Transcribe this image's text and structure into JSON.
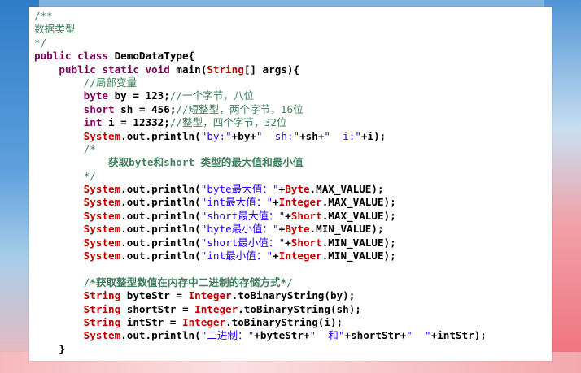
{
  "lines": [
    {
      "parts": [
        {
          "t": "/**",
          "c": "cmt"
        }
      ]
    },
    {
      "parts": [
        {
          "t": "数据类型",
          "c": "cmt"
        }
      ]
    },
    {
      "parts": [
        {
          "t": "*/",
          "c": "cmt"
        }
      ]
    },
    {
      "parts": [
        {
          "t": "public class ",
          "c": "kw"
        },
        {
          "t": "DemoDataType{",
          "c": "plain"
        }
      ]
    },
    {
      "parts": [
        {
          "t": "    public static void ",
          "c": "kw"
        },
        {
          "t": "main(",
          "c": "plain"
        },
        {
          "t": "String",
          "c": "type-cls"
        },
        {
          "t": "[] args){",
          "c": "plain"
        }
      ]
    },
    {
      "parts": [
        {
          "t": "        //局部变量",
          "c": "cmt"
        }
      ]
    },
    {
      "parts": [
        {
          "t": "        byte ",
          "c": "kw"
        },
        {
          "t": "by = 123;",
          "c": "plain"
        },
        {
          "t": "//一个字节，八位",
          "c": "cmt"
        }
      ]
    },
    {
      "parts": [
        {
          "t": "        short ",
          "c": "kw"
        },
        {
          "t": "sh = 456;",
          "c": "plain"
        },
        {
          "t": "//短整型，两个字节，16位",
          "c": "cmt"
        }
      ]
    },
    {
      "parts": [
        {
          "t": "        int ",
          "c": "kw"
        },
        {
          "t": "i = 12332;",
          "c": "plain"
        },
        {
          "t": "//整型，四个字节，32位",
          "c": "cmt"
        }
      ]
    },
    {
      "parts": [
        {
          "t": "        System",
          "c": "sys"
        },
        {
          "t": ".out.println(",
          "c": "plain"
        },
        {
          "t": "\"by:\"",
          "c": "str"
        },
        {
          "t": "+by+",
          "c": "plain"
        },
        {
          "t": "\"  sh:\"",
          "c": "str"
        },
        {
          "t": "+sh+",
          "c": "plain"
        },
        {
          "t": "\"  i:\"",
          "c": "str"
        },
        {
          "t": "+i);",
          "c": "plain"
        }
      ]
    },
    {
      "parts": [
        {
          "t": "        /*",
          "c": "cmt"
        }
      ]
    },
    {
      "parts": [
        {
          "t": "            获取byte和short 类型的最大值和最小值",
          "c": "cmt-bold"
        }
      ]
    },
    {
      "parts": [
        {
          "t": "        */",
          "c": "cmt"
        }
      ]
    },
    {
      "parts": [
        {
          "t": "        System",
          "c": "sys"
        },
        {
          "t": ".out.println(",
          "c": "plain"
        },
        {
          "t": "\"byte最大值：\"",
          "c": "str"
        },
        {
          "t": "+",
          "c": "plain"
        },
        {
          "t": "Byte",
          "c": "type-cls"
        },
        {
          "t": ".MAX_VALUE);",
          "c": "plain"
        }
      ]
    },
    {
      "parts": [
        {
          "t": "        System",
          "c": "sys"
        },
        {
          "t": ".out.println(",
          "c": "plain"
        },
        {
          "t": "\"int最大值：\"",
          "c": "str"
        },
        {
          "t": "+",
          "c": "plain"
        },
        {
          "t": "Integer",
          "c": "type-cls"
        },
        {
          "t": ".MAX_VALUE);",
          "c": "plain"
        }
      ]
    },
    {
      "parts": [
        {
          "t": "        System",
          "c": "sys"
        },
        {
          "t": ".out.println(",
          "c": "plain"
        },
        {
          "t": "\"short最大值：\"",
          "c": "str"
        },
        {
          "t": "+",
          "c": "plain"
        },
        {
          "t": "Short",
          "c": "type-cls"
        },
        {
          "t": ".MAX_VALUE);",
          "c": "plain"
        }
      ]
    },
    {
      "parts": [
        {
          "t": "        System",
          "c": "sys"
        },
        {
          "t": ".out.println(",
          "c": "plain"
        },
        {
          "t": "\"byte最小值：\"",
          "c": "str"
        },
        {
          "t": "+",
          "c": "plain"
        },
        {
          "t": "Byte",
          "c": "type-cls"
        },
        {
          "t": ".MIN_VALUE);",
          "c": "plain"
        }
      ]
    },
    {
      "parts": [
        {
          "t": "        System",
          "c": "sys"
        },
        {
          "t": ".out.println(",
          "c": "plain"
        },
        {
          "t": "\"short最小值：\"",
          "c": "str"
        },
        {
          "t": "+",
          "c": "plain"
        },
        {
          "t": "Short",
          "c": "type-cls"
        },
        {
          "t": ".MIN_VALUE);",
          "c": "plain"
        }
      ]
    },
    {
      "parts": [
        {
          "t": "        System",
          "c": "sys"
        },
        {
          "t": ".out.println(",
          "c": "plain"
        },
        {
          "t": "\"int最小值：\"",
          "c": "str"
        },
        {
          "t": "+",
          "c": "plain"
        },
        {
          "t": "Integer",
          "c": "type-cls"
        },
        {
          "t": ".MIN_VALUE);",
          "c": "plain"
        }
      ]
    },
    {
      "parts": [
        {
          "t": " ",
          "c": "plain"
        }
      ]
    },
    {
      "parts": [
        {
          "t": "        /*获取整型数值在内存中二进制的存储方式*/",
          "c": "cmt-bold"
        }
      ]
    },
    {
      "parts": [
        {
          "t": "        String ",
          "c": "type-cls"
        },
        {
          "t": "byteStr = ",
          "c": "plain"
        },
        {
          "t": "Integer",
          "c": "type-cls"
        },
        {
          "t": ".toBinaryString(by);",
          "c": "plain"
        }
      ]
    },
    {
      "parts": [
        {
          "t": "        String ",
          "c": "type-cls"
        },
        {
          "t": "shortStr = ",
          "c": "plain"
        },
        {
          "t": "Integer",
          "c": "type-cls"
        },
        {
          "t": ".toBinaryString(sh);",
          "c": "plain"
        }
      ]
    },
    {
      "parts": [
        {
          "t": "        String ",
          "c": "type-cls"
        },
        {
          "t": "intStr = ",
          "c": "plain"
        },
        {
          "t": "Integer",
          "c": "type-cls"
        },
        {
          "t": ".toBinaryString(i);",
          "c": "plain"
        }
      ]
    },
    {
      "parts": [
        {
          "t": "        System",
          "c": "sys"
        },
        {
          "t": ".out.println(",
          "c": "plain"
        },
        {
          "t": "\"二进制：\"",
          "c": "str"
        },
        {
          "t": "+byteStr+",
          "c": "plain"
        },
        {
          "t": "\"  和\"",
          "c": "str"
        },
        {
          "t": "+shortStr+",
          "c": "plain"
        },
        {
          "t": "\"  \"",
          "c": "str"
        },
        {
          "t": "+intStr);",
          "c": "plain"
        }
      ]
    },
    {
      "parts": [
        {
          "t": "    }",
          "c": "plain"
        }
      ]
    }
  ]
}
